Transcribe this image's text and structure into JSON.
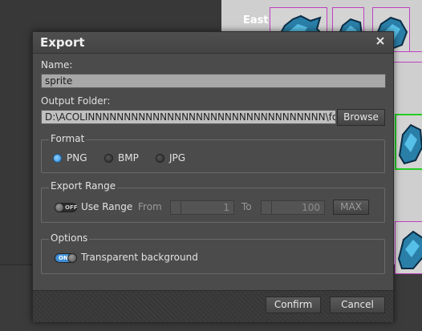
{
  "background": {
    "direction_label": "East"
  },
  "dialog": {
    "title": "Export",
    "close_glyph": "×",
    "name_label": "Name:",
    "name_value": "sprite",
    "output_folder_label": "Output Folder:",
    "output_folder_value": "D:\\ACOLINNNNNNNNNNNNNNNNNNNNNNNNNNNNNNNNN\\forgotten",
    "browse_label": "Browse",
    "format": {
      "title": "Format",
      "options": [
        "PNG",
        "BMP",
        "JPG"
      ],
      "selected": "PNG"
    },
    "export_range": {
      "title": "Export Range",
      "toggle_state": "OFF",
      "use_range_label": "Use Range",
      "from_label": "From",
      "from_value": "1",
      "to_label": "To",
      "to_value": "100",
      "max_label": "MAX"
    },
    "options": {
      "title": "Options",
      "toggle_state": "ON",
      "transparent_label": "Transparent background"
    },
    "confirm_label": "Confirm",
    "cancel_label": "Cancel"
  },
  "colors": {
    "accent": "#3f8fd8",
    "selection_border": "#22cc22",
    "frame_border": "#c040c0"
  }
}
